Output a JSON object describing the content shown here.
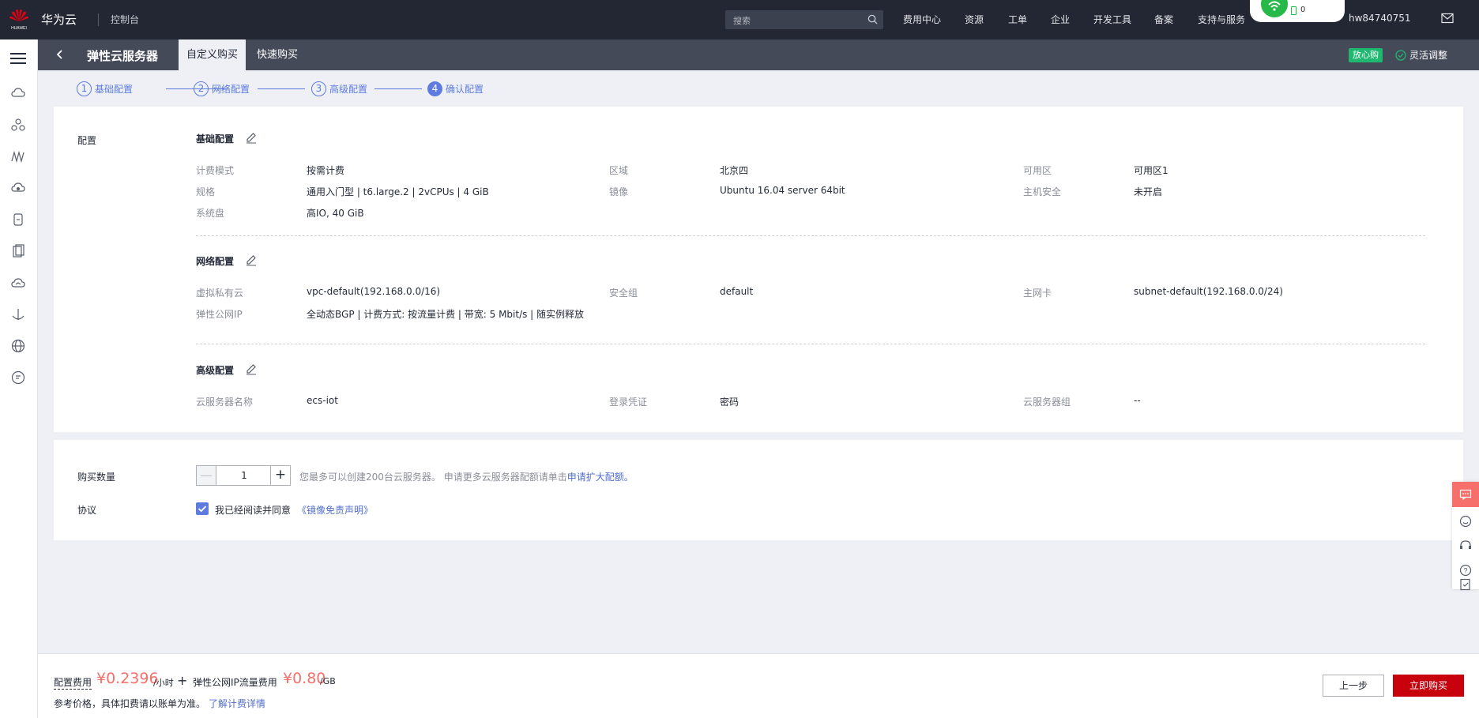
{
  "topbar": {
    "brand": "华为云",
    "console": "控制台",
    "search_placeholder": "搜索",
    "nav": [
      "费用中心",
      "资源",
      "工单",
      "企业",
      "开发工具",
      "备案",
      "支持与服务"
    ],
    "float_count": "0",
    "username": "hw84740751"
  },
  "service": {
    "title": "弹性云服务器",
    "tabs": [
      "自定义购买",
      "快速购买"
    ],
    "badge": "放心购",
    "flex_adjust": "灵活调整"
  },
  "steps": [
    {
      "num": "1",
      "label": "基础配置"
    },
    {
      "num": "2",
      "label": "网络配置"
    },
    {
      "num": "3",
      "label": "高级配置"
    },
    {
      "num": "4",
      "label": "确认配置"
    }
  ],
  "config": {
    "section_label": "配置",
    "basic": {
      "title": "基础配置",
      "billing_key": "计费模式",
      "billing_val": "按需计费",
      "region_key": "区域",
      "region_val": "北京四",
      "az_key": "可用区",
      "az_val": "可用区1",
      "spec_key": "规格",
      "spec_val": "通用入门型 | t6.large.2 | 2vCPUs | 4 GiB",
      "image_key": "镜像",
      "image_val": "Ubuntu 16.04 server 64bit",
      "hostsec_key": "主机安全",
      "hostsec_val": "未开启",
      "disk_key": "系统盘",
      "disk_val": "高IO, 40 GiB"
    },
    "network": {
      "title": "网络配置",
      "vpc_key": "虚拟私有云",
      "vpc_val": "vpc-default(192.168.0.0/16)",
      "sg_key": "安全组",
      "sg_val": "default",
      "nic_key": "主网卡",
      "nic_val": "subnet-default(192.168.0.0/24)",
      "eip_key": "弹性公网IP",
      "eip_val": "全动态BGP |  计费方式: 按流量计费 |  带宽: 5 Mbit/s | 随实例释放"
    },
    "advanced": {
      "title": "高级配置",
      "name_key": "云服务器名称",
      "name_val": "ecs-iot",
      "login_key": "登录凭证",
      "login_val": "密码",
      "group_key": "云服务器组",
      "group_val": "--"
    }
  },
  "purchase": {
    "qty_label": "购买数量",
    "qty_minus": "—",
    "qty_value": "1",
    "qty_plus": "+",
    "hint": "您最多可以创建200台云服务器。 申请更多云服务器配额请单击",
    "hint_link": "申请扩大配额。",
    "agreement_label": "协议",
    "agree_text": "我已经阅读并同意",
    "agree_link": "《镜像免责声明》"
  },
  "footer": {
    "fee_label": "配置费用",
    "price": "¥0.2396",
    "price_unit": "/小时",
    "plus": "+",
    "eip_label": "弹性公网IP流量费用",
    "eip_price": "¥0.80",
    "eip_unit": "/GB",
    "ref_text": "参考价格，具体扣费请以账单为准。",
    "ref_link": "了解计费详情",
    "prev_label": "上一步",
    "buy_label": "立即购买"
  },
  "colors": {
    "accent": "#5e7ce0",
    "price": "#f66f6a",
    "buy": "#c7000b",
    "badge": "#1fb871"
  }
}
